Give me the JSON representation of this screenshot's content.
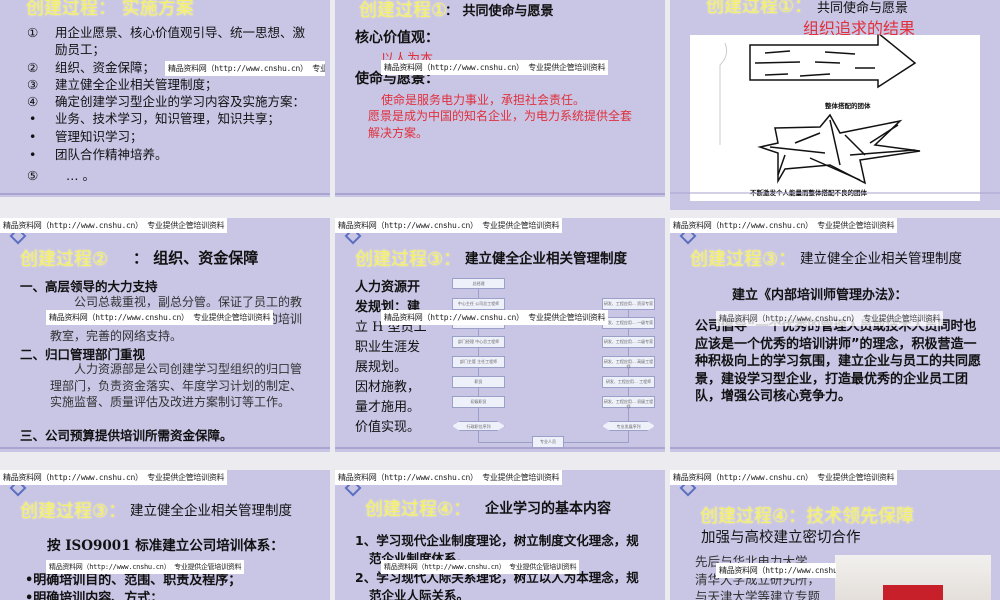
{
  "watermark": "精品资料网（http://www.cnshu.cn） 专业提供企管培训资料",
  "slides": [
    {
      "title": "创建过程： 实施方案",
      "items": [
        {
          "marker": "①",
          "text": "用企业愿景、核心价值观引导、统一思想、激励员工；"
        },
        {
          "marker": "②",
          "text": "组织、资金保障；"
        },
        {
          "marker": "③",
          "text": "建立健全企业相关管理制度；"
        },
        {
          "marker": "④",
          "text": "确定创建学习型企业的学习内容及实施方案："
        },
        {
          "marker": "•",
          "text": "业务、技术学习，知识管理，知识共享；"
        },
        {
          "marker": "•",
          "text": "管理知识学习；"
        },
        {
          "marker": "•",
          "text": "团队合作精神培养。"
        },
        {
          "marker": "⑤",
          "text": "… 。"
        }
      ]
    },
    {
      "title": "创建过程①",
      "subtitle": "：  共同使命与愿景",
      "core_label": "核心价值观：",
      "core_value": "以人为本",
      "mission_label": "使命与愿景：",
      "mission": "使命是服务电力事业，承担社会责任。",
      "vision": "愿景是成为中国的知名企业，为电力系统提供全套解决方案。"
    },
    {
      "title": "创建过程①：",
      "subtitle": "共同使命与愿景",
      "heading": "组织追求的结果",
      "caption_top": "整体搭配的团体",
      "caption_bottom": "不断激发个人能量而整体搭配不良的团体"
    },
    {
      "title": "创建过程②",
      "subtitle": "：  组织、资金保障",
      "sections": [
        {
          "heading": "一、高层领导的大力支持",
          "text": "公司总裁重视，副总分管。保证了员工的教育开发计划围绕公司战略进行；设备先进的培训教室，完善的网络支持。"
        },
        {
          "heading": "二、归口管理部门重视",
          "text": "人力资源部是公司创建学习型组织的归口管理部门，负责资金落实、年度学习计划的制定、实施监督、质量评估及改进方案制订等工作。"
        },
        {
          "heading": "三、公司预算提供培训所需资金保障。",
          "text": ""
        }
      ]
    },
    {
      "title": "创建过程③：",
      "subtitle": "建立健全企业相关管理制度",
      "left_text": [
        "人力资源开",
        "发规划：建",
        "立 H 型员工",
        "职业生涯发",
        "展规划。",
        "因材施教，",
        "量才施用。",
        "价值实现。"
      ],
      "admin_track": [
        "总经理",
        "中心主任 公司总工程师",
        "中心副主任 公司副总工程师",
        "部门经理 中心总工程师",
        "部门主管 主任工程师",
        "职员",
        "初级职员"
      ],
      "admin_diamond": "行政职位序列",
      "tech_track": [
        "研发、工程应用… 资深专家",
        "研发、工程应用… 一级专家",
        "研发、工程应用… 二级专家",
        "研发、工程应用… 高级工程师",
        "研发、工程应用… 工程师",
        "研发、工程应用… 初级工程师"
      ],
      "tech_diamond": "专业发展序列",
      "bottom_box": "专业人员"
    },
    {
      "title": "创建过程③：",
      "subtitle": "建立健全企业相关管理制度",
      "heading": "建立《内部培训师管理办法》：",
      "text": "公司倡导“一个优秀的管理人员或技术人员同时也应该是一个优秀的培训讲师”的理念，积极营造一种积极向上的学习氛围，建立企业与员工的共同愿景，建设学习型企业，打造最优秀的企业员工团队，增强公司核心竞争力。"
    },
    {
      "title": "创建过程③：",
      "subtitle": "建立健全企业相关管理制度",
      "heading": "按 ISO9001 标准建立公司培训体系：",
      "bullets": [
        "•明确培训目的、范围、职责及程序；",
        "•明确培训内容、方式；"
      ]
    },
    {
      "title": "创建过程④：",
      "subtitle": "企业学习的基本内容",
      "items": [
        "1、学习现代企业制度理论，树立制度文化理念，规范企业制度体系。",
        "2、学习现代人际关系理论，树立以人为本理念，规范企业人际关系。"
      ]
    },
    {
      "title": "创建过程④：技术领先保障",
      "subtitle": "加强与高校建立密切合作",
      "lines": [
        "先后与华北电力大学、",
        "清华大学成立研究所，",
        "与天津大学等建立专题"
      ]
    }
  ]
}
